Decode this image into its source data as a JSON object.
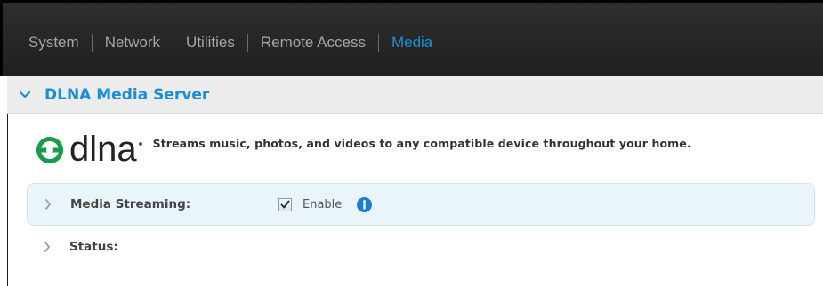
{
  "nav": {
    "items": [
      {
        "label": "System",
        "active": false
      },
      {
        "label": "Network",
        "active": false
      },
      {
        "label": "Utilities",
        "active": false
      },
      {
        "label": "Remote Access",
        "active": false
      },
      {
        "label": "Media",
        "active": true
      }
    ]
  },
  "section": {
    "title": "DLNA Media Server",
    "icon": "chevron-down-icon"
  },
  "dlna": {
    "logo_text": "dlna",
    "description": "Streams music, photos, and videos to any compatible device throughout your home."
  },
  "settings": {
    "media_streaming": {
      "label": "Media Streaming:",
      "checkbox_checked": true,
      "checkbox_label": "Enable",
      "info_icon": "info-icon"
    },
    "status": {
      "label": "Status:"
    }
  },
  "colors": {
    "accent": "#1b8ed8",
    "nav_bg": "#262626",
    "nav_text": "#a6a6a6",
    "row_highlight": "#e9f4fb",
    "info_icon": "#1b7fd4",
    "dlna_logo_green": "#1a9b4b"
  }
}
